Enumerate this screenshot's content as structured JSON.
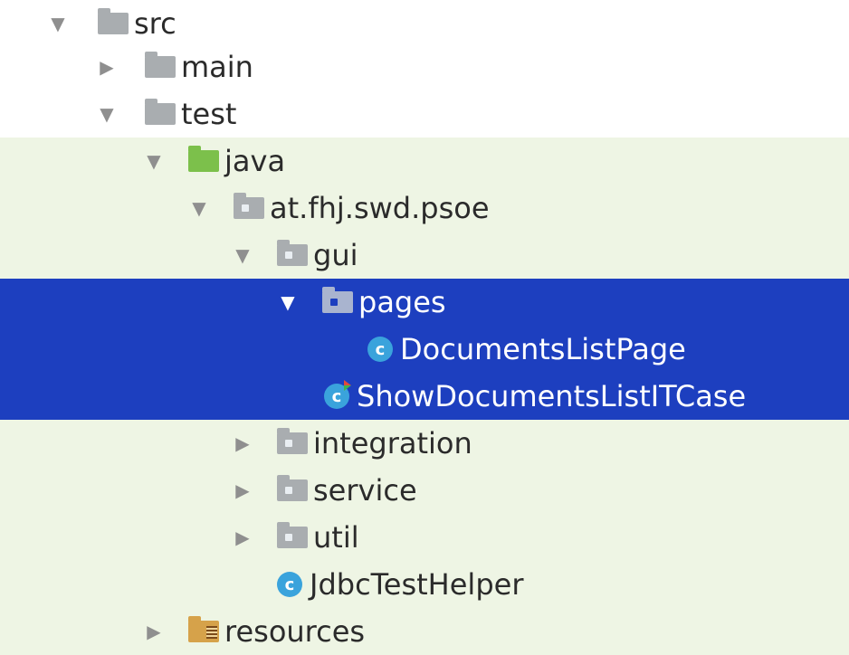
{
  "tree": {
    "nodes": [
      {
        "id": "src",
        "arrow": "▼",
        "icon": "folder-icon",
        "label": "src"
      },
      {
        "id": "main",
        "arrow": "▶",
        "icon": "folder-icon",
        "label": "main"
      },
      {
        "id": "test",
        "arrow": "▼",
        "icon": "folder-icon",
        "label": "test"
      },
      {
        "id": "java",
        "arrow": "▼",
        "icon": "test-source-folder-icon",
        "label": "java"
      },
      {
        "id": "pkg-root",
        "arrow": "▼",
        "icon": "package-icon",
        "label": "at.fhj.swd.psoe"
      },
      {
        "id": "gui",
        "arrow": "▼",
        "icon": "package-icon",
        "label": "gui"
      },
      {
        "id": "pages",
        "arrow": "▼",
        "icon": "package-icon",
        "label": "pages",
        "selected": true
      },
      {
        "id": "documents-list-page",
        "icon": "class-icon",
        "label": "DocumentsListPage",
        "icon_letter": "c",
        "selected": true
      },
      {
        "id": "show-documents-list-itcase",
        "icon": "test-class-icon",
        "label": "ShowDocumentsListITCase",
        "icon_letter": "c",
        "selected": true
      },
      {
        "id": "integration",
        "arrow": "▶",
        "icon": "package-icon",
        "label": "integration"
      },
      {
        "id": "service",
        "arrow": "▶",
        "icon": "package-icon",
        "label": "service"
      },
      {
        "id": "util",
        "arrow": "▶",
        "icon": "package-icon",
        "label": "util"
      },
      {
        "id": "jdbc-test-helper",
        "icon": "class-icon",
        "label": "JdbcTestHelper",
        "icon_letter": "c"
      },
      {
        "id": "resources",
        "arrow": "▶",
        "icon": "resources-folder-icon",
        "label": "resources"
      }
    ]
  },
  "colors": {
    "selection": "#1d3fbf",
    "test_background": "#eef5e4",
    "class_icon": "#3aa3dc",
    "test_folder": "#7cc04b"
  }
}
